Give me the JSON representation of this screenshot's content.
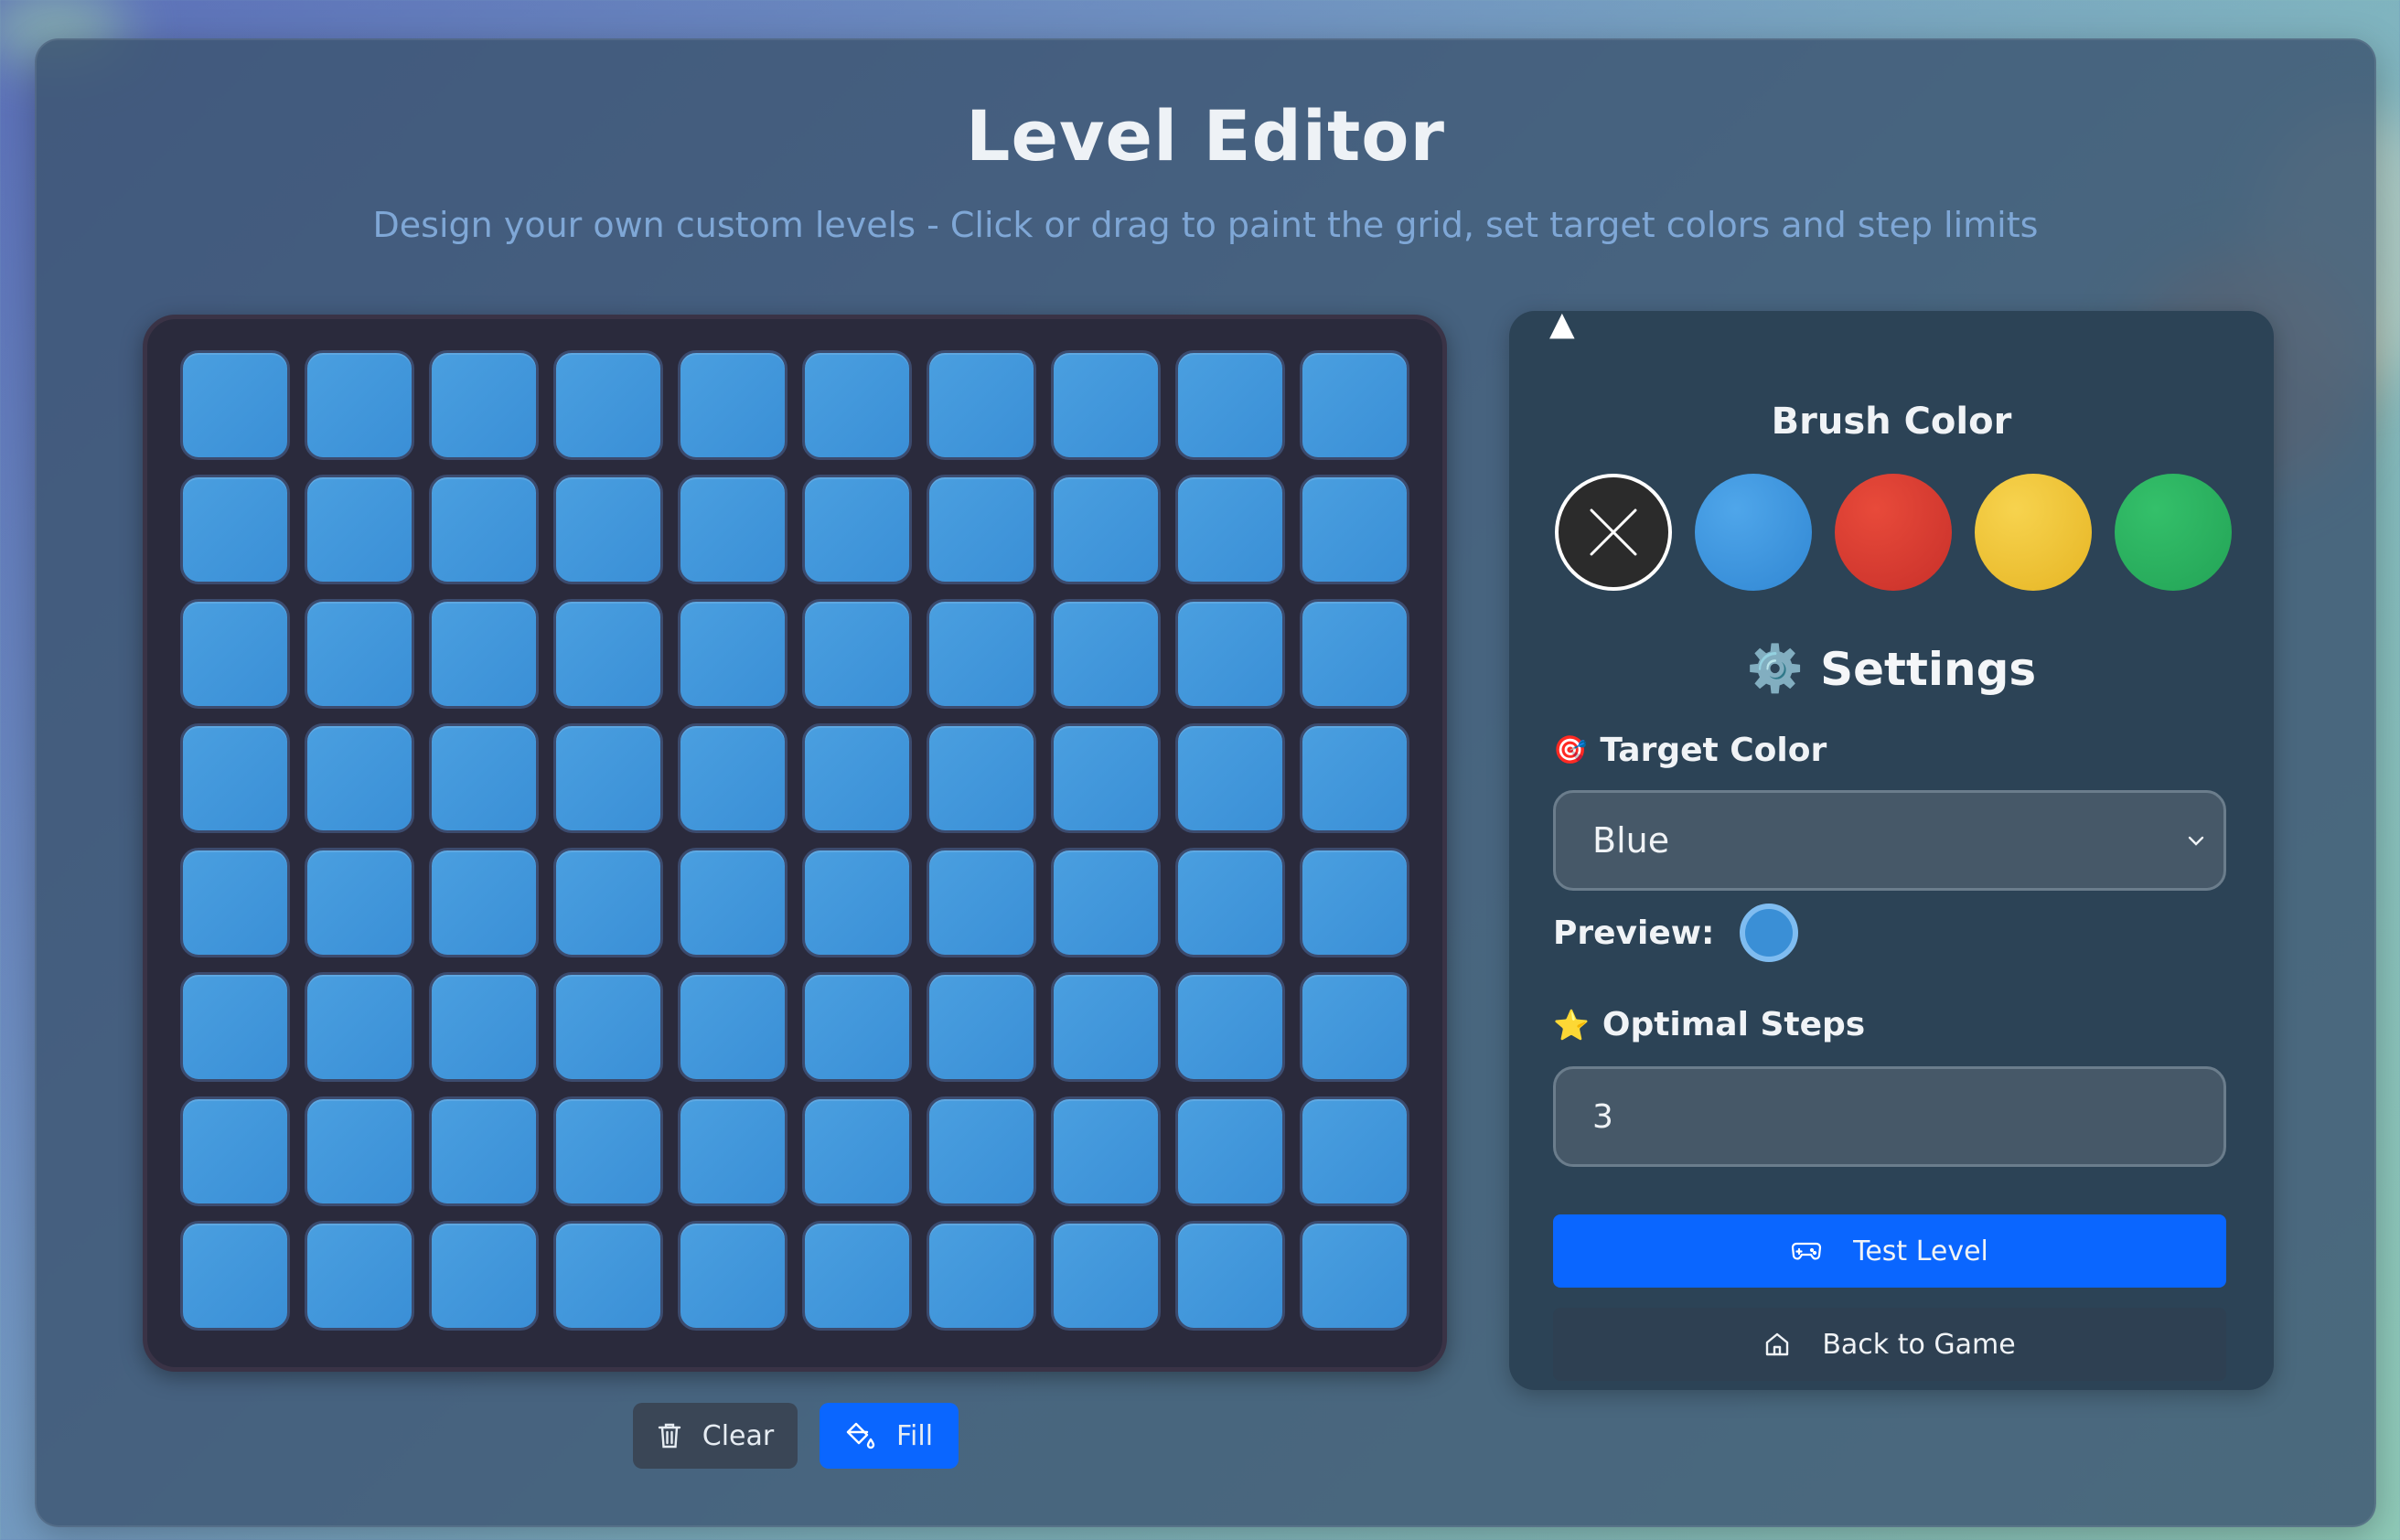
{
  "header": {
    "title": "Level Editor",
    "subtitle": "Design your own custom levels - Click or drag to paint the grid, set target colors and step limits"
  },
  "grid": {
    "rows": 8,
    "columns": 10,
    "cell_color": "blue",
    "cell_hex": "#3a8fd6"
  },
  "board_actions": {
    "clear_label": "Clear",
    "fill_label": "Fill"
  },
  "brush": {
    "heading": "Brush Color",
    "selected": "none",
    "selected_marker": "▲",
    "options": [
      {
        "name": "none",
        "hex": "#2b2b2b"
      },
      {
        "name": "blue",
        "hex": "#3a8fd6"
      },
      {
        "name": "red",
        "hex": "#d83a2e"
      },
      {
        "name": "yellow",
        "hex": "#f0c438"
      },
      {
        "name": "green",
        "hex": "#2ab25e"
      }
    ]
  },
  "settings": {
    "heading": "Settings",
    "heading_icon": "⚙️",
    "target_color_icon": "🎯",
    "target_color_label": "Target Color",
    "target_color_value": "Blue",
    "preview_label": "Preview:",
    "preview_hex": "#3a8fd6",
    "optimal_steps_icon": "⭐",
    "optimal_steps_label": "Optimal Steps",
    "optimal_steps_value": "3"
  },
  "panel_actions": {
    "test_label": "Test Level",
    "back_label": "Back to Game"
  }
}
